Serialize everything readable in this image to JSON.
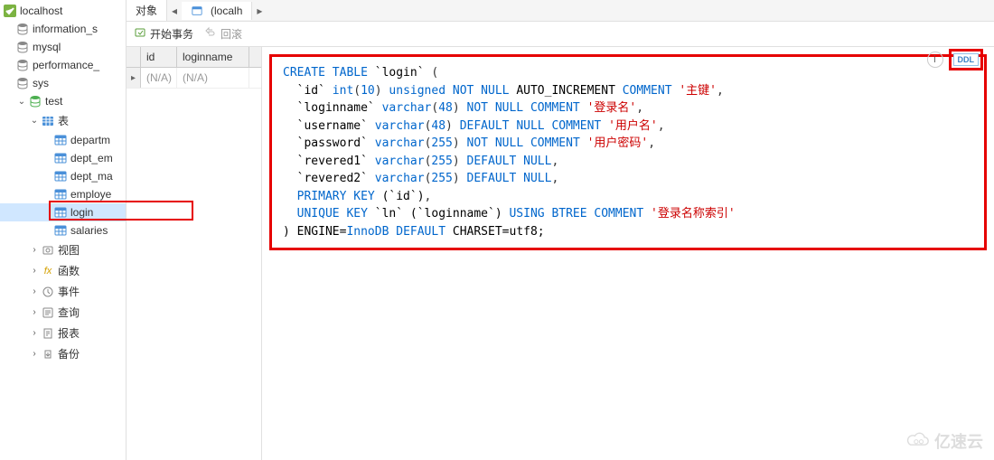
{
  "tree": {
    "connection": "localhost",
    "dbs": [
      "information_s",
      "mysql",
      "performance_",
      "sys"
    ],
    "active_db": "test",
    "tables_label": "表",
    "tables": [
      "departm",
      "dept_em",
      "dept_ma",
      "employe",
      "login",
      "salaries"
    ],
    "views": "视图",
    "functions": "函数",
    "events": "事件",
    "queries": "查询",
    "reports": "报表",
    "backup": "备份"
  },
  "tabs": {
    "obj": "对象",
    "current": "(localh"
  },
  "toolbar": {
    "begin_trans": "开始事务",
    "rollback": "回滚"
  },
  "grid": {
    "col_id": "id",
    "col_login": "loginname",
    "na": "(N/A)"
  },
  "top_buttons": {
    "info": "i",
    "ddl": "DDL"
  },
  "ddl": {
    "create": "CREATE TABLE",
    "tbl": "`login`",
    "open": " (",
    "id_col": "`id`",
    "int": "int",
    "int_sz": "10",
    "unsigned": "unsigned",
    "notnull": "NOT NULL",
    "autoinc": "AUTO_INCREMENT",
    "comment": "COMMENT",
    "c_id": "'主键'",
    "login_col": "`loginname`",
    "varchar": "varchar",
    "sz48": "48",
    "c_login": "'登录名'",
    "user_col": "`username`",
    "defaultnull": "DEFAULT NULL",
    "c_user": "'用户名'",
    "pwd_col": "`password`",
    "sz255": "255",
    "c_pwd": "'用户密码'",
    "rev1": "`revered1`",
    "rev2": "`revered2`",
    "pk": "PRIMARY KEY",
    "pk_col": "(`id`)",
    "uk": "UNIQUE KEY",
    "uk_name": "`ln`",
    "uk_col": "(`loginname`)",
    "using": "USING BTREE",
    "c_idx": "'登录名称索引'",
    "engine": ") ENGINE=",
    "innodb": "InnoDB",
    "default": "DEFAULT",
    "charset": " CHARSET=utf8;"
  },
  "watermark": "亿速云"
}
